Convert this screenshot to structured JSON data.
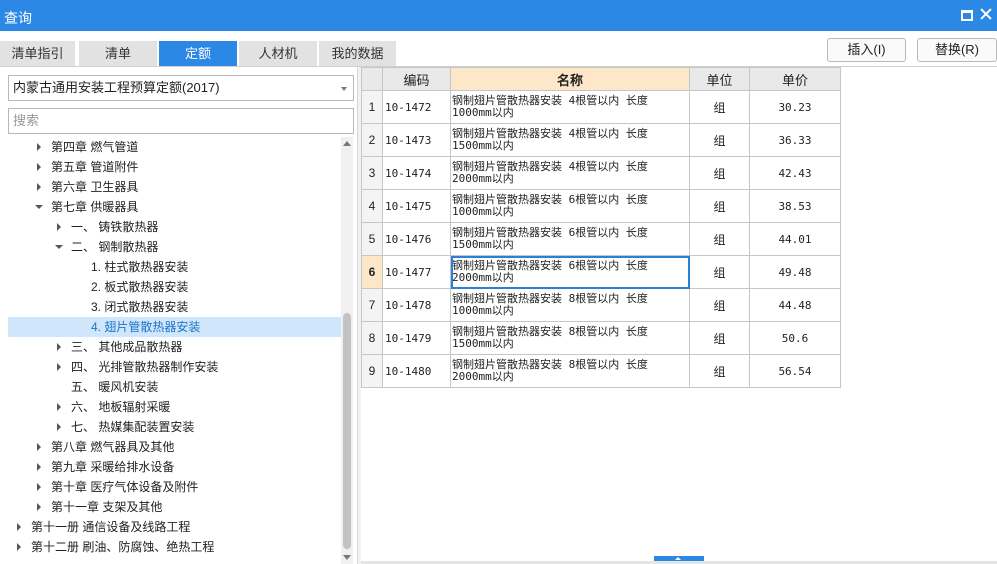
{
  "window": {
    "title": "查询"
  },
  "tabs": [
    {
      "label": "清单指引",
      "active": false
    },
    {
      "label": "清单",
      "active": false
    },
    {
      "label": "定额",
      "active": true
    },
    {
      "label": "人材机",
      "active": false
    },
    {
      "label": "我的数据",
      "active": false
    }
  ],
  "actions": {
    "insert_label": "插入(I)",
    "replace_label": "替换(R)"
  },
  "left": {
    "library_select": "内蒙古通用安装工程预算定额(2017)",
    "search_placeholder": "搜索"
  },
  "tree": [
    {
      "label": "第四章 燃气管道",
      "state": "collapsed"
    },
    {
      "label": "第五章 管道附件",
      "state": "collapsed"
    },
    {
      "label": "第六章 卫生器具",
      "state": "collapsed"
    },
    {
      "label": "第七章 供暖器具",
      "state": "expanded"
    },
    {
      "label": "一、 铸铁散热器",
      "state": "collapsed"
    },
    {
      "label": "二、 钢制散热器",
      "state": "expanded"
    },
    {
      "label": "1. 柱式散热器安装",
      "state": "leaf"
    },
    {
      "label": "2. 板式散热器安装",
      "state": "leaf"
    },
    {
      "label": "3. 闭式散热器安装",
      "state": "leaf"
    },
    {
      "label": "4. 翅片管散热器安装",
      "state": "leaf",
      "selected": true
    },
    {
      "label": "三、 其他成品散热器",
      "state": "collapsed"
    },
    {
      "label": "四、 光排管散热器制作安装",
      "state": "collapsed"
    },
    {
      "label": "五、 暖风机安装",
      "state": "leaf"
    },
    {
      "label": "六、 地板辐射采暖",
      "state": "collapsed"
    },
    {
      "label": "七、 热媒集配装置安装",
      "state": "collapsed"
    },
    {
      "label": "第八章 燃气器具及其他",
      "state": "collapsed"
    },
    {
      "label": "第九章 采暖给排水设备",
      "state": "collapsed"
    },
    {
      "label": "第十章 医疗气体设备及附件",
      "state": "collapsed"
    },
    {
      "label": "第十一章 支架及其他",
      "state": "collapsed"
    },
    {
      "label": "第十一册 通信设备及线路工程",
      "state": "collapsed"
    },
    {
      "label": "第十二册 刷油、防腐蚀、绝热工程",
      "state": "collapsed"
    }
  ],
  "grid": {
    "headers": {
      "code": "编码",
      "name": "名称",
      "unit": "单位",
      "price": "单价"
    },
    "current_row": 6,
    "rows": [
      {
        "index": "1",
        "code": "10-1472",
        "name_line1": "钢制翅片管散热器安装 4根管以内 长度",
        "name_line2": "1000mm以内",
        "unit": "组",
        "price": "30.23"
      },
      {
        "index": "2",
        "code": "10-1473",
        "name_line1": "钢制翅片管散热器安装 4根管以内 长度",
        "name_line2": "1500mm以内",
        "unit": "组",
        "price": "36.33"
      },
      {
        "index": "3",
        "code": "10-1474",
        "name_line1": "钢制翅片管散热器安装 4根管以内 长度",
        "name_line2": "2000mm以内",
        "unit": "组",
        "price": "42.43"
      },
      {
        "index": "4",
        "code": "10-1475",
        "name_line1": "钢制翅片管散热器安装 6根管以内 长度",
        "name_line2": "1000mm以内",
        "unit": "组",
        "price": "38.53"
      },
      {
        "index": "5",
        "code": "10-1476",
        "name_line1": "钢制翅片管散热器安装 6根管以内 长度",
        "name_line2": "1500mm以内",
        "unit": "组",
        "price": "44.01"
      },
      {
        "index": "6",
        "code": "10-1477",
        "name_line1": "钢制翅片管散热器安装 6根管以内 长度",
        "name_line2": "2000mm以内",
        "unit": "组",
        "price": "49.48"
      },
      {
        "index": "7",
        "code": "10-1478",
        "name_line1": "钢制翅片管散热器安装 8根管以内 长度",
        "name_line2": "1000mm以内",
        "unit": "组",
        "price": "44.48"
      },
      {
        "index": "8",
        "code": "10-1479",
        "name_line1": "钢制翅片管散热器安装 8根管以内 长度",
        "name_line2": "1500mm以内",
        "unit": "组",
        "price": "50.6"
      },
      {
        "index": "9",
        "code": "10-1480",
        "name_line1": "钢制翅片管散热器安装 8根管以内 长度",
        "name_line2": "2000mm以内",
        "unit": "组",
        "price": "56.54"
      }
    ]
  }
}
